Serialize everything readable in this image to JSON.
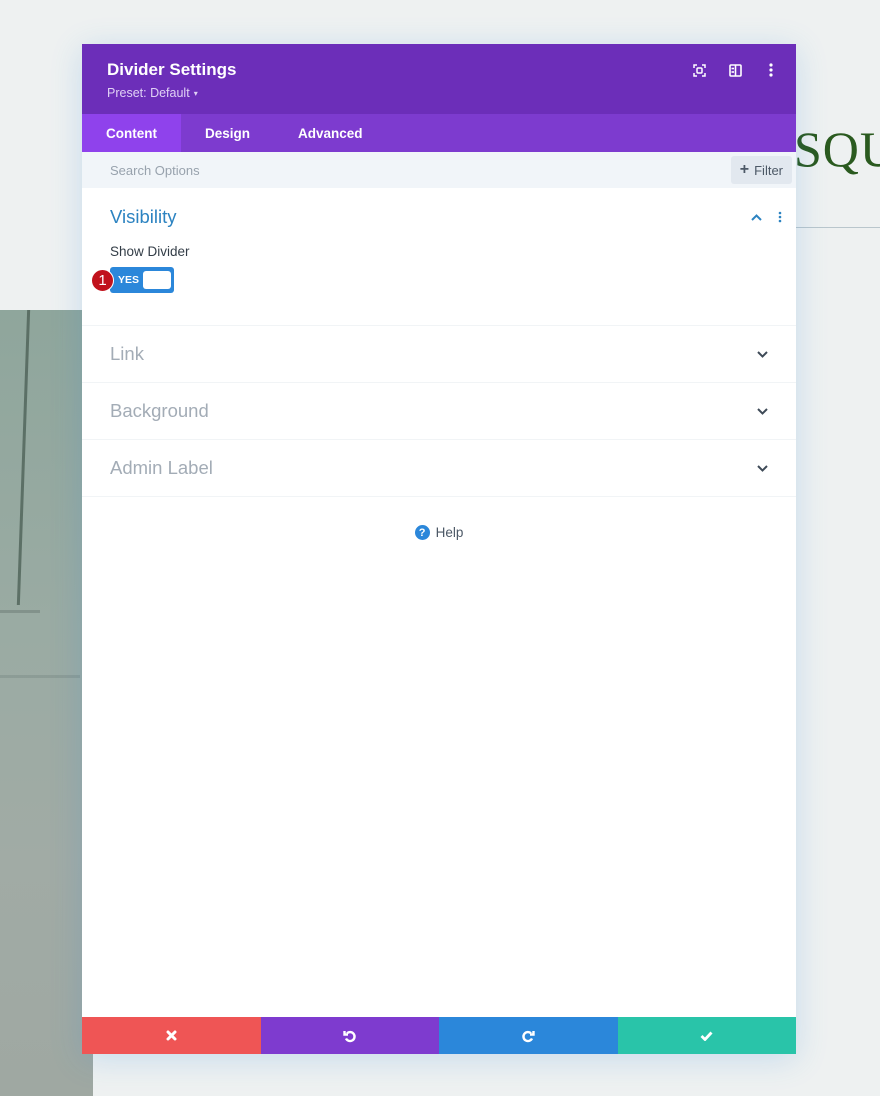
{
  "background": {
    "title_fragment": "SQU"
  },
  "modal": {
    "title": "Divider Settings",
    "preset_label": "Preset: Default",
    "preset_caret": "▾",
    "header_icons": [
      "focus-mode-icon",
      "split-view-icon",
      "more-options-icon"
    ],
    "tabs": [
      {
        "label": "Content",
        "active": true
      },
      {
        "label": "Design",
        "active": false
      },
      {
        "label": "Advanced",
        "active": false
      }
    ],
    "search": {
      "placeholder": "Search Options",
      "value": ""
    },
    "filter_label": "Filter",
    "filter_plus": "+",
    "sections": [
      {
        "title": "Visibility",
        "open": true,
        "fields": [
          {
            "label": "Show Divider",
            "type": "toggle",
            "value": "YES",
            "annotation_badge": "1"
          }
        ]
      },
      {
        "title": "Link",
        "open": false
      },
      {
        "title": "Background",
        "open": false
      },
      {
        "title": "Admin Label",
        "open": false
      }
    ],
    "help": {
      "icon": "?",
      "label": "Help"
    },
    "footer_buttons": [
      {
        "name": "discard",
        "icon": "close-icon",
        "color": "#ef5555"
      },
      {
        "name": "undo",
        "icon": "undo-icon",
        "color": "#7e3bcf"
      },
      {
        "name": "redo",
        "icon": "redo-icon",
        "color": "#2b87da"
      },
      {
        "name": "save",
        "icon": "check-icon",
        "color": "#29c4a9"
      }
    ]
  },
  "colors": {
    "header": "#6c2eb9",
    "tabs": "#7d3bcf",
    "active_tab": "#8f42ec",
    "accent_blue": "#2b87da",
    "badge_red": "#c1121c"
  }
}
